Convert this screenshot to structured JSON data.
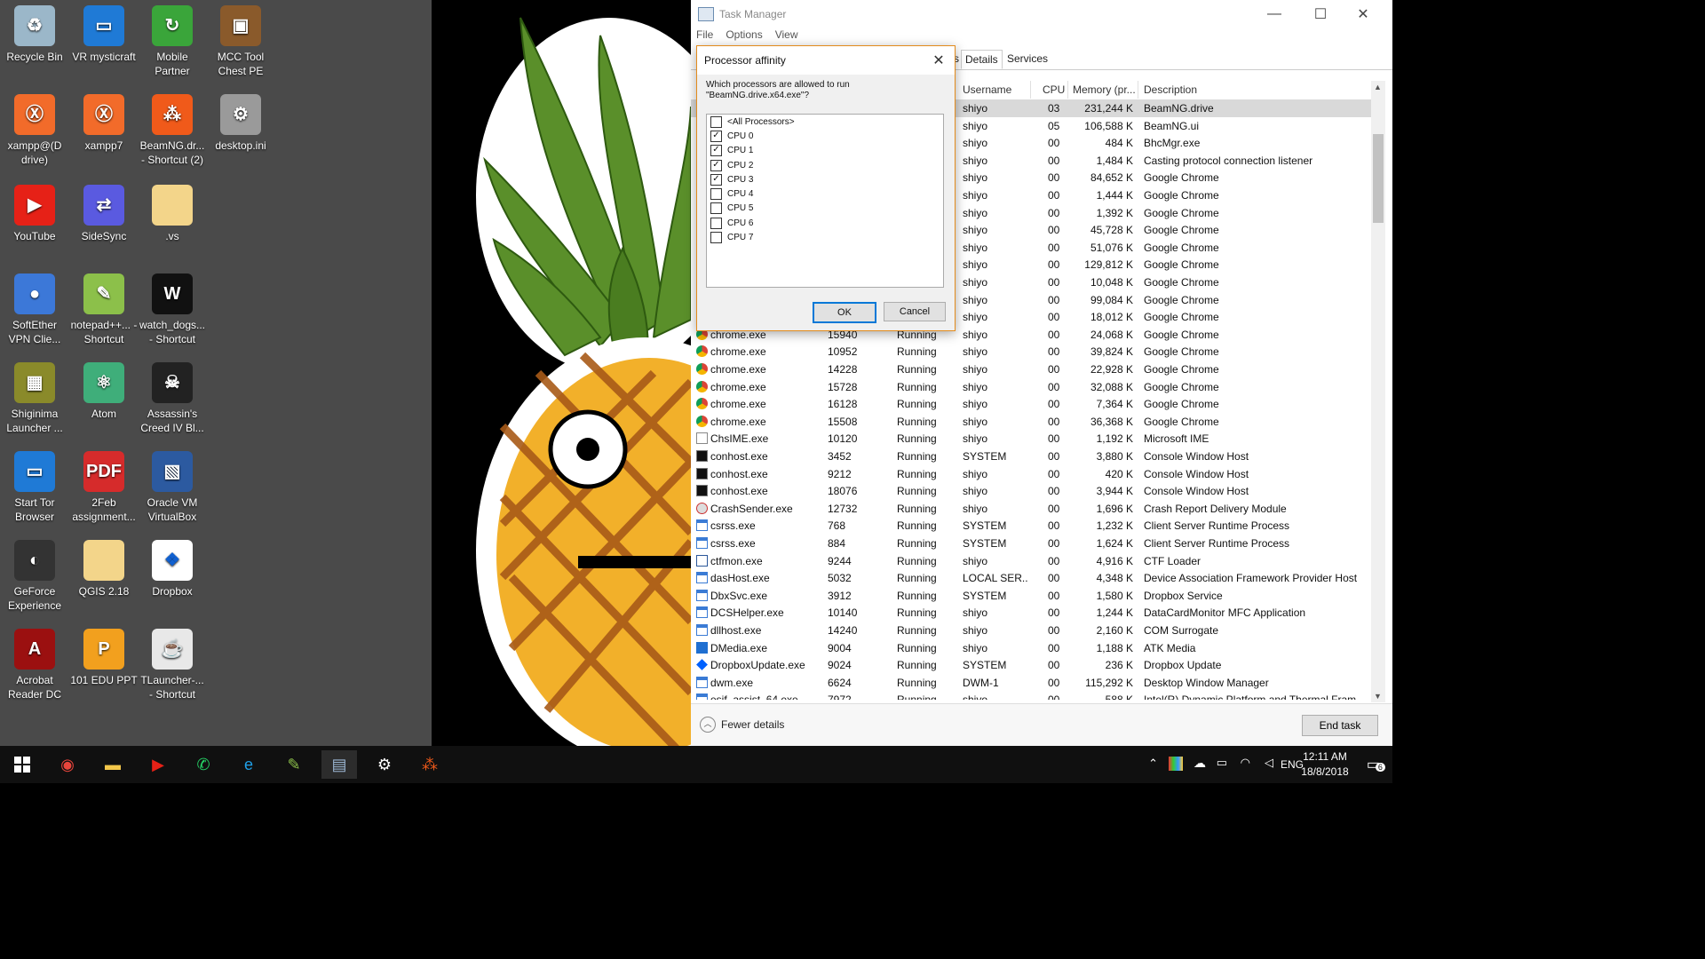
{
  "desktop_icons": [
    {
      "label": "Recycle Bin",
      "color": "#9bb7c9",
      "glyph": "♻",
      "col": 0,
      "row": 0,
      "shortcut": false
    },
    {
      "label": "VR mysticraft",
      "color": "#1f7ad6",
      "glyph": "▭",
      "col": 1,
      "row": 0,
      "shortcut": true
    },
    {
      "label": "Mobile Partner",
      "color": "#3aa53a",
      "glyph": "↻",
      "col": 2,
      "row": 0,
      "shortcut": true
    },
    {
      "label": "MCC Tool Chest PE",
      "color": "#8a5a2b",
      "glyph": "▣",
      "col": 3,
      "row": 0,
      "shortcut": true
    },
    {
      "label": "xampp@(D drive)",
      "color": "#f26b2a",
      "glyph": "Ⓧ",
      "col": 0,
      "row": 1,
      "shortcut": true
    },
    {
      "label": "xampp7",
      "color": "#f26b2a",
      "glyph": "Ⓧ",
      "col": 1,
      "row": 1,
      "shortcut": true
    },
    {
      "label": "BeamNG.dr... - Shortcut (2)",
      "color": "#f05a1a",
      "glyph": "⁂",
      "col": 2,
      "row": 1,
      "shortcut": true
    },
    {
      "label": "desktop.ini",
      "color": "#9a9a9a",
      "glyph": "⚙",
      "col": 3,
      "row": 1,
      "shortcut": false
    },
    {
      "label": "YouTube",
      "color": "#e62117",
      "glyph": "▶",
      "col": 0,
      "row": 2,
      "shortcut": true
    },
    {
      "label": "SideSync",
      "color": "#5a5ae0",
      "glyph": "⇄",
      "col": 1,
      "row": 2,
      "shortcut": true
    },
    {
      "label": ".vs",
      "color": "#f3d58a",
      "glyph": "",
      "col": 2,
      "row": 2,
      "shortcut": false
    },
    {
      "label": "SoftEther VPN Clie...",
      "color": "#3c78d8",
      "glyph": "●",
      "col": 0,
      "row": 3,
      "shortcut": true
    },
    {
      "label": "notepad++... - Shortcut",
      "color": "#8cc04a",
      "glyph": "✎",
      "col": 1,
      "row": 3,
      "shortcut": true
    },
    {
      "label": "watch_dogs... - Shortcut",
      "color": "#111111",
      "glyph": "W",
      "col": 2,
      "row": 3,
      "shortcut": true
    },
    {
      "label": "Shiginima Launcher ...",
      "color": "#8a8a2a",
      "glyph": "▦",
      "col": 0,
      "row": 4,
      "shortcut": true
    },
    {
      "label": "Atom",
      "color": "#3fae7a",
      "glyph": "⚛",
      "col": 1,
      "row": 4,
      "shortcut": false
    },
    {
      "label": "Assassin's Creed IV Bl...",
      "color": "#222222",
      "glyph": "☠",
      "col": 2,
      "row": 4,
      "shortcut": true
    },
    {
      "label": "Start Tor Browser",
      "color": "#1f7ad6",
      "glyph": "▭",
      "col": 0,
      "row": 5,
      "shortcut": true
    },
    {
      "label": "2Feb assignment...",
      "color": "#d62b2b",
      "glyph": "PDF",
      "col": 1,
      "row": 5,
      "shortcut": true
    },
    {
      "label": "Oracle VM VirtualBox",
      "color": "#2c5aa0",
      "glyph": "▧",
      "col": 2,
      "row": 5,
      "shortcut": true
    },
    {
      "label": "GeForce Experience",
      "color": "#333333",
      "glyph": "◐",
      "col": 0,
      "row": 6,
      "shortcut": true
    },
    {
      "label": "QGIS 2.18",
      "color": "#f3d58a",
      "glyph": "",
      "col": 1,
      "row": 6,
      "shortcut": false
    },
    {
      "label": "Dropbox",
      "color": "#ffffff",
      "glyph": "❖",
      "col": 2,
      "row": 6,
      "shortcut": true
    },
    {
      "label": "Acrobat Reader DC",
      "color": "#9b1010",
      "glyph": "A",
      "col": 0,
      "row": 7,
      "shortcut": true
    },
    {
      "label": "101 EDU PPT",
      "color": "#f2a01e",
      "glyph": "P",
      "col": 1,
      "row": 7,
      "shortcut": false
    },
    {
      "label": "TLauncher-... - Shortcut",
      "color": "#e8e8e8",
      "glyph": "☕",
      "col": 2,
      "row": 7,
      "shortcut": true
    }
  ],
  "task_manager": {
    "title": "Task Manager",
    "menu": [
      "File",
      "Options",
      "View"
    ],
    "tabs": [
      {
        "label": "s",
        "active": false
      },
      {
        "label": "Details",
        "active": true
      },
      {
        "label": "Services",
        "active": false
      }
    ],
    "columns": {
      "username": "Username",
      "cpu": "CPU",
      "memory": "Memory (pr...",
      "description": "Description"
    },
    "top_rows": [
      {
        "user": "shiyo",
        "cpu": "03",
        "mem": "231,244 K",
        "desc": "BeamNG.drive",
        "selected": true
      },
      {
        "user": "shiyo",
        "cpu": "05",
        "mem": "106,588 K",
        "desc": "BeamNG.ui"
      },
      {
        "user": "shiyo",
        "cpu": "00",
        "mem": "484 K",
        "desc": "BhcMgr.exe"
      },
      {
        "user": "shiyo",
        "cpu": "00",
        "mem": "1,484 K",
        "desc": "Casting protocol connection listener"
      },
      {
        "user": "shiyo",
        "cpu": "00",
        "mem": "84,652 K",
        "desc": "Google Chrome"
      },
      {
        "user": "shiyo",
        "cpu": "00",
        "mem": "1,444 K",
        "desc": "Google Chrome"
      },
      {
        "user": "shiyo",
        "cpu": "00",
        "mem": "1,392 K",
        "desc": "Google Chrome"
      },
      {
        "user": "shiyo",
        "cpu": "00",
        "mem": "45,728 K",
        "desc": "Google Chrome"
      },
      {
        "user": "shiyo",
        "cpu": "00",
        "mem": "51,076 K",
        "desc": "Google Chrome"
      },
      {
        "user": "shiyo",
        "cpu": "00",
        "mem": "129,812 K",
        "desc": "Google Chrome"
      },
      {
        "user": "shiyo",
        "cpu": "00",
        "mem": "10,048 K",
        "desc": "Google Chrome"
      },
      {
        "user": "shiyo",
        "cpu": "00",
        "mem": "99,084 K",
        "desc": "Google Chrome"
      },
      {
        "user": "shiyo",
        "cpu": "00",
        "mem": "18,012 K",
        "desc": "Google Chrome"
      }
    ],
    "rows": [
      {
        "name": "chrome.exe",
        "pid": "15940",
        "status": "Running",
        "user": "shiyo",
        "cpu": "00",
        "mem": "24,068 K",
        "desc": "Google Chrome",
        "icon": "chrome"
      },
      {
        "name": "chrome.exe",
        "pid": "10952",
        "status": "Running",
        "user": "shiyo",
        "cpu": "00",
        "mem": "39,824 K",
        "desc": "Google Chrome",
        "icon": "chrome"
      },
      {
        "name": "chrome.exe",
        "pid": "14228",
        "status": "Running",
        "user": "shiyo",
        "cpu": "00",
        "mem": "22,928 K",
        "desc": "Google Chrome",
        "icon": "chrome"
      },
      {
        "name": "chrome.exe",
        "pid": "15728",
        "status": "Running",
        "user": "shiyo",
        "cpu": "00",
        "mem": "32,088 K",
        "desc": "Google Chrome",
        "icon": "chrome"
      },
      {
        "name": "chrome.exe",
        "pid": "16128",
        "status": "Running",
        "user": "shiyo",
        "cpu": "00",
        "mem": "7,364 K",
        "desc": "Google Chrome",
        "icon": "chrome"
      },
      {
        "name": "chrome.exe",
        "pid": "15508",
        "status": "Running",
        "user": "shiyo",
        "cpu": "00",
        "mem": "36,368 K",
        "desc": "Google Chrome",
        "icon": "chrome"
      },
      {
        "name": "ChsIME.exe",
        "pid": "10120",
        "status": "Running",
        "user": "shiyo",
        "cpu": "00",
        "mem": "1,192 K",
        "desc": "Microsoft IME",
        "icon": "ime"
      },
      {
        "name": "conhost.exe",
        "pid": "3452",
        "status": "Running",
        "user": "SYSTEM",
        "cpu": "00",
        "mem": "3,880 K",
        "desc": "Console Window Host",
        "icon": "console"
      },
      {
        "name": "conhost.exe",
        "pid": "9212",
        "status": "Running",
        "user": "shiyo",
        "cpu": "00",
        "mem": "420 K",
        "desc": "Console Window Host",
        "icon": "console"
      },
      {
        "name": "conhost.exe",
        "pid": "18076",
        "status": "Running",
        "user": "shiyo",
        "cpu": "00",
        "mem": "3,944 K",
        "desc": "Console Window Host",
        "icon": "console"
      },
      {
        "name": "CrashSender.exe",
        "pid": "12732",
        "status": "Running",
        "user": "shiyo",
        "cpu": "00",
        "mem": "1,696 K",
        "desc": "Crash Report Delivery Module",
        "icon": "crash"
      },
      {
        "name": "csrss.exe",
        "pid": "768",
        "status": "Running",
        "user": "SYSTEM",
        "cpu": "00",
        "mem": "1,232 K",
        "desc": "Client Server Runtime Process",
        "icon": "window"
      },
      {
        "name": "csrss.exe",
        "pid": "884",
        "status": "Running",
        "user": "SYSTEM",
        "cpu": "00",
        "mem": "1,624 K",
        "desc": "Client Server Runtime Process",
        "icon": "window"
      },
      {
        "name": "ctfmon.exe",
        "pid": "9244",
        "status": "Running",
        "user": "shiyo",
        "cpu": "00",
        "mem": "4,916 K",
        "desc": "CTF Loader",
        "icon": "pen"
      },
      {
        "name": "dasHost.exe",
        "pid": "5032",
        "status": "Running",
        "user": "LOCAL SER...",
        "cpu": "00",
        "mem": "4,348 K",
        "desc": "Device Association Framework Provider Host",
        "icon": "window"
      },
      {
        "name": "DbxSvc.exe",
        "pid": "3912",
        "status": "Running",
        "user": "SYSTEM",
        "cpu": "00",
        "mem": "1,580 K",
        "desc": "Dropbox Service",
        "icon": "window"
      },
      {
        "name": "DCSHelper.exe",
        "pid": "10140",
        "status": "Running",
        "user": "shiyo",
        "cpu": "00",
        "mem": "1,244 K",
        "desc": "DataCardMonitor MFC Application",
        "icon": "window"
      },
      {
        "name": "dllhost.exe",
        "pid": "14240",
        "status": "Running",
        "user": "shiyo",
        "cpu": "00",
        "mem": "2,160 K",
        "desc": "COM Surrogate",
        "icon": "window"
      },
      {
        "name": "DMedia.exe",
        "pid": "9004",
        "status": "Running",
        "user": "shiyo",
        "cpu": "00",
        "mem": "1,188 K",
        "desc": "ATK Media",
        "icon": "dmedia"
      },
      {
        "name": "DropboxUpdate.exe",
        "pid": "9024",
        "status": "Running",
        "user": "SYSTEM",
        "cpu": "00",
        "mem": "236 K",
        "desc": "Dropbox Update",
        "icon": "dropbox"
      },
      {
        "name": "dwm.exe",
        "pid": "6624",
        "status": "Running",
        "user": "DWM-1",
        "cpu": "00",
        "mem": "115,292 K",
        "desc": "Desktop Window Manager",
        "icon": "window"
      },
      {
        "name": "esif_assist_64.exe",
        "pid": "7972",
        "status": "Running",
        "user": "shiyo",
        "cpu": "00",
        "mem": "588 K",
        "desc": "Intel(R) Dynamic Platform and Thermal Fram...",
        "icon": "window"
      }
    ],
    "fewer_details": "Fewer details",
    "end_task": "End task"
  },
  "dialog": {
    "title": "Processor affinity",
    "question": "Which processors are allowed to run \"BeamNG.drive.x64.exe\"?",
    "options": [
      {
        "label": "<All Processors>",
        "checked": false
      },
      {
        "label": "CPU 0",
        "checked": true
      },
      {
        "label": "CPU 1",
        "checked": true
      },
      {
        "label": "CPU 2",
        "checked": true
      },
      {
        "label": "CPU 3",
        "checked": true
      },
      {
        "label": "CPU 4",
        "checked": false
      },
      {
        "label": "CPU 5",
        "checked": false
      },
      {
        "label": "CPU 6",
        "checked": false
      },
      {
        "label": "CPU 7",
        "checked": false
      }
    ],
    "ok": "OK",
    "cancel": "Cancel",
    "accent": "#e38b1c"
  },
  "taskbar": {
    "apps": [
      {
        "name": "chrome-icon",
        "glyph": "◉",
        "color": "#e8453c"
      },
      {
        "name": "file-explorer-icon",
        "glyph": "▬",
        "color": "#f3c74a"
      },
      {
        "name": "youtube-icon",
        "glyph": "▶",
        "color": "#e62117"
      },
      {
        "name": "whatsapp-icon",
        "glyph": "✆",
        "color": "#25d366"
      },
      {
        "name": "internet-explorer-icon",
        "glyph": "e",
        "color": "#1fa0e8"
      },
      {
        "name": "notepad-plus-plus-icon",
        "glyph": "✎",
        "color": "#8cc04a"
      },
      {
        "name": "task-manager-icon",
        "glyph": "▤",
        "color": "#9cb7d4"
      },
      {
        "name": "settings-icon",
        "glyph": "⚙",
        "color": "#ffffff"
      },
      {
        "name": "beamng-icon",
        "glyph": "⁂",
        "color": "#f05a1a"
      }
    ],
    "language": "ENG",
    "time": "12:11 AM",
    "date": "18/8/2018",
    "notifications": "6"
  }
}
